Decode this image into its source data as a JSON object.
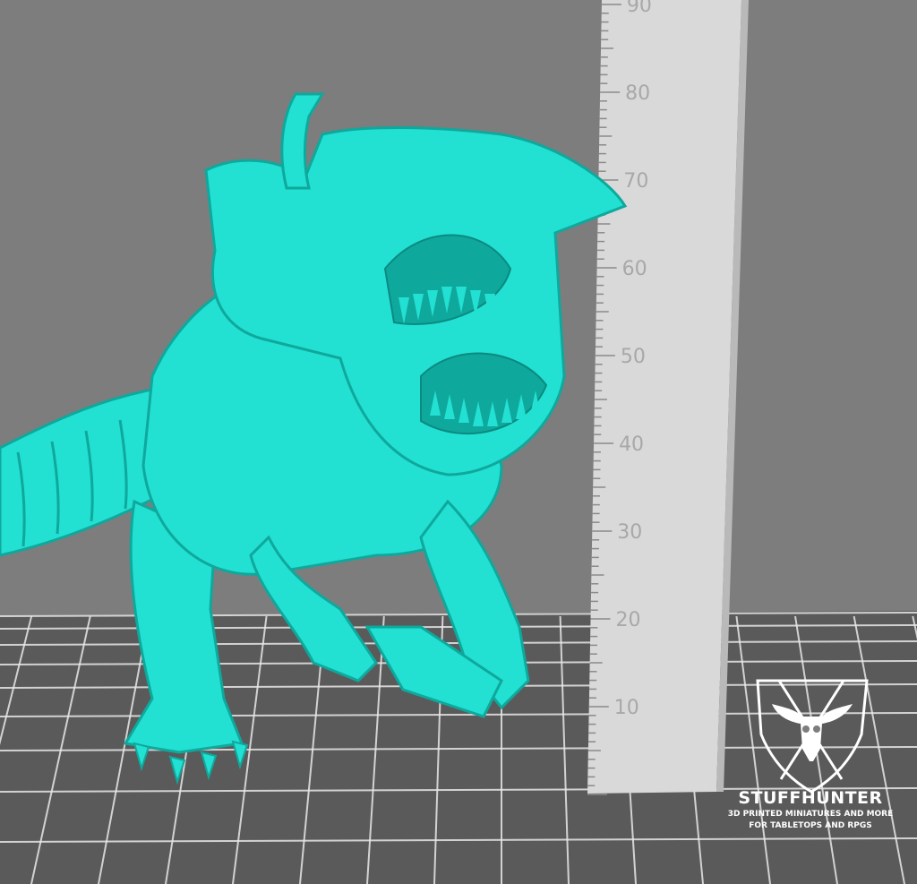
{
  "scene": {
    "background_color": "#7d7d7d",
    "floor_color": "#5a5a5a",
    "grid_line_color": "#e8e8e8",
    "model_color": "#22e0d2",
    "model_shadow_color": "#0fa89c",
    "ruler_color": "#d9d9d9"
  },
  "ruler": {
    "labels": [
      "10",
      "20",
      "30",
      "40",
      "50",
      "60",
      "70",
      "80",
      "90"
    ]
  },
  "brand": {
    "name": "STUFFHUNTER",
    "tagline_1": "3D PRINTED MINIATURES AND MORE",
    "tagline_2": "FOR TABLETOPS AND RPGS",
    "logo_icon": "bull-skull-shield-icon"
  }
}
